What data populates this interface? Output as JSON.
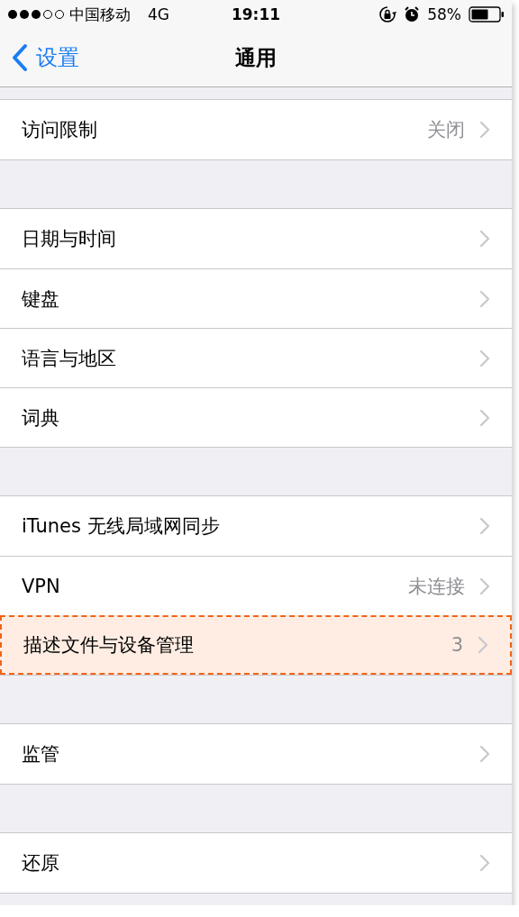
{
  "status_bar": {
    "carrier": "中国移动",
    "network": "4G",
    "time": "19:11",
    "battery_text": "58%"
  },
  "nav_bar": {
    "back_label": "设置",
    "title": "通用"
  },
  "groups": [
    {
      "rows": [
        {
          "label": "访问限制",
          "value": "关闭",
          "highlighted": false
        }
      ]
    },
    {
      "rows": [
        {
          "label": "日期与时间",
          "highlighted": false
        },
        {
          "label": "键盘",
          "highlighted": false
        },
        {
          "label": "语言与地区",
          "highlighted": false
        },
        {
          "label": "词典",
          "highlighted": false
        }
      ]
    },
    {
      "rows": [
        {
          "label": "iTunes 无线局域网同步",
          "highlighted": false
        },
        {
          "label": "VPN",
          "value": "未连接",
          "highlighted": false
        },
        {
          "label": "描述文件与设备管理",
          "value": "3",
          "highlighted": true
        }
      ]
    },
    {
      "rows": [
        {
          "label": "监管",
          "highlighted": false
        }
      ]
    },
    {
      "rows": [
        {
          "label": "还原",
          "highlighted": false
        }
      ]
    }
  ]
}
